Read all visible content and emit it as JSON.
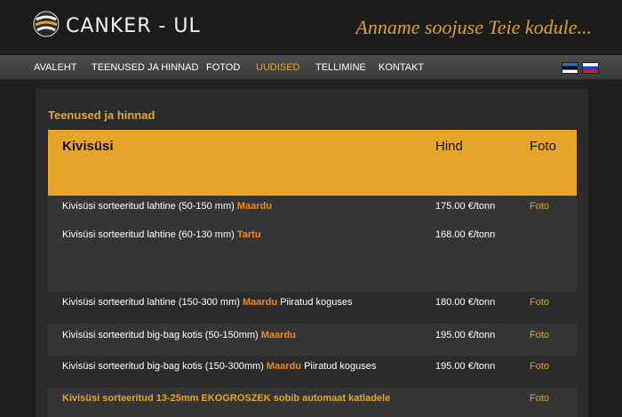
{
  "header": {
    "logo_text": "CANKER - UL",
    "slogan": "Anname soojuse Teie kodule..."
  },
  "nav": {
    "items": [
      "AVALEHT",
      "TEENUSED JA HINNAD",
      "FOTOD",
      "UUDISED",
      "TELLIMINE",
      "KONTAKT"
    ],
    "active": "UUDISED"
  },
  "flags": [
    "estonian-flag",
    "russian-flag"
  ],
  "colors": {
    "accent": "#e5a52b",
    "highlight": "#f08a24"
  },
  "section_title": "Teenused ja hinnad",
  "table": {
    "headers": {
      "product": "Kivisüsi",
      "price": "Hind",
      "photo": "Foto"
    },
    "rows": [
      {
        "name": "Kivisüsi sorteeritud lahtine (50-150 mm)",
        "loc": "Maardu",
        "note": "",
        "price": "175.00 €/tonn",
        "photo": "Foto"
      },
      {
        "name": "Kivisüsi sorteeritud lahtine (60-130 mm)",
        "loc": "Tartu",
        "note": "",
        "price": "168.00 €/tonn",
        "photo": ""
      },
      {
        "name": "Kivisüsi sorteeritud lahtine (150-300 mm) ",
        "loc": "Maardu",
        "note": "Piiratud koguses",
        "price": "180.00 €/tonn",
        "photo": "Foto"
      },
      {
        "name": "Kivisüsi sorteeritud big-bag kotis (50-150mm)",
        "loc": "Maardu",
        "note": "",
        "price": "195.00 €/tonn",
        "photo": "Foto"
      },
      {
        "name": "Kivisüsi sorteeritud big-bag kotis (150-300mm)",
        "loc": "Maardu",
        "note": "Piiratud koguses",
        "price": "195.00 €/tonn",
        "photo": "Foto"
      },
      {
        "name": "Kivisüsi sorteeritud 13-25mm EKOGROSZEK sobib automaat katladele",
        "loc": "",
        "note": "",
        "price": "",
        "photo": "Foto"
      }
    ]
  }
}
